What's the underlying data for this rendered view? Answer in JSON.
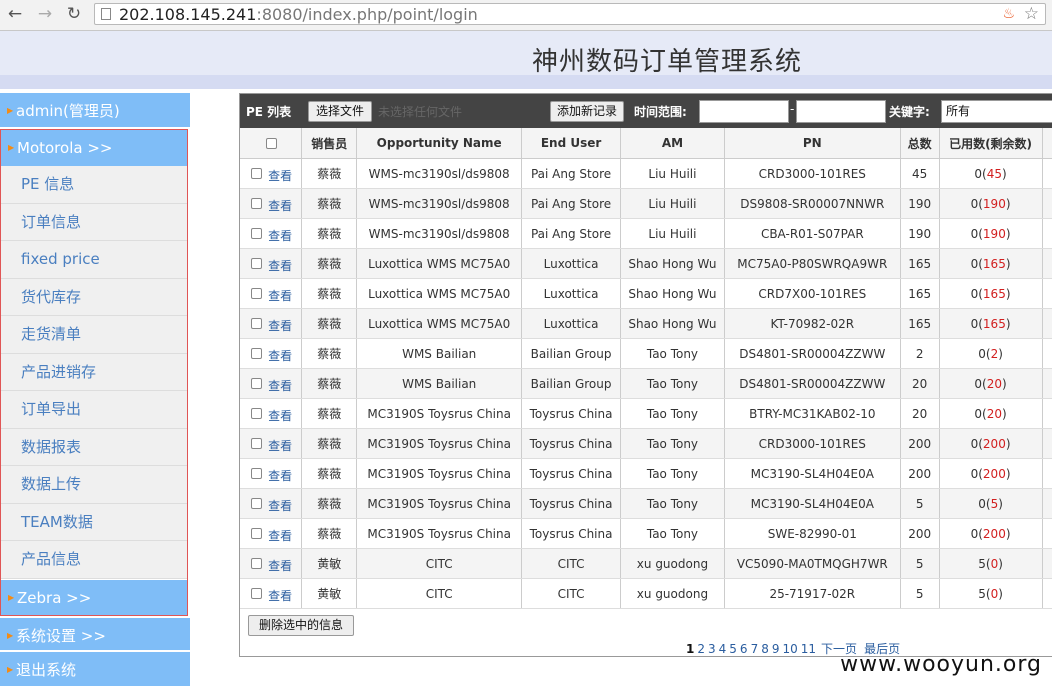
{
  "browser": {
    "url_host": "202.108.145.241",
    "url_rest": ":8080/index.php/point/login"
  },
  "header": {
    "title": "神州数码订单管理系统"
  },
  "sidebar": {
    "admin": "admin(管理员)",
    "motorola": "Motorola >>",
    "items": [
      "PE 信息",
      "订单信息",
      "fixed price",
      "货代库存",
      "走货清单",
      "产品进销存",
      "订单导出",
      "数据报表",
      "数据上传",
      "TEAM数据",
      "产品信息"
    ],
    "zebra": "Zebra >>",
    "settings": "系统设置 >>",
    "logout": "退出系统"
  },
  "toolbar": {
    "list_label": "PE 列表",
    "choose_file": "选择文件",
    "no_file": "未选择任何文件",
    "add_record": "添加新记录",
    "time_range_label": "时间范围:",
    "date_separator": "-",
    "keyword_label": "关键字:",
    "keyword_value": "所有"
  },
  "table": {
    "columns": [
      "",
      "销售员",
      "Opportunity Name",
      "End User",
      "AM",
      "PN",
      "总数",
      "已用数(剩余数)"
    ],
    "view_label": "查看",
    "rows": [
      {
        "sales": "蔡薇",
        "opportunity": "WMS-mc3190sl/ds9808",
        "end_user": "Pai Ang Store",
        "am": "Liu Huili",
        "pn": "CRD3000-101RES",
        "total": "45",
        "used": "0",
        "remaining": "45"
      },
      {
        "sales": "蔡薇",
        "opportunity": "WMS-mc3190sl/ds9808",
        "end_user": "Pai Ang Store",
        "am": "Liu Huili",
        "pn": "DS9808-SR00007NNWR",
        "total": "190",
        "used": "0",
        "remaining": "190"
      },
      {
        "sales": "蔡薇",
        "opportunity": "WMS-mc3190sl/ds9808",
        "end_user": "Pai Ang Store",
        "am": "Liu Huili",
        "pn": "CBA-R01-S07PAR",
        "total": "190",
        "used": "0",
        "remaining": "190"
      },
      {
        "sales": "蔡薇",
        "opportunity": "Luxottica WMS MC75A0",
        "end_user": "Luxottica",
        "am": "Shao Hong Wu",
        "pn": "MC75A0-P80SWRQA9WR",
        "total": "165",
        "used": "0",
        "remaining": "165"
      },
      {
        "sales": "蔡薇",
        "opportunity": "Luxottica WMS MC75A0",
        "end_user": "Luxottica",
        "am": "Shao Hong Wu",
        "pn": "CRD7X00-101RES",
        "total": "165",
        "used": "0",
        "remaining": "165"
      },
      {
        "sales": "蔡薇",
        "opportunity": "Luxottica WMS MC75A0",
        "end_user": "Luxottica",
        "am": "Shao Hong Wu",
        "pn": "KT-70982-02R",
        "total": "165",
        "used": "0",
        "remaining": "165"
      },
      {
        "sales": "蔡薇",
        "opportunity": "WMS Bailian",
        "end_user": "Bailian Group",
        "am": "Tao Tony",
        "pn": "DS4801-SR00004ZZWW",
        "total": "2",
        "used": "0",
        "remaining": "2"
      },
      {
        "sales": "蔡薇",
        "opportunity": "WMS Bailian",
        "end_user": "Bailian Group",
        "am": "Tao Tony",
        "pn": "DS4801-SR00004ZZWW",
        "total": "20",
        "used": "0",
        "remaining": "20"
      },
      {
        "sales": "蔡薇",
        "opportunity": "MC3190S Toysrus China",
        "end_user": "Toysrus China",
        "am": "Tao Tony",
        "pn": "BTRY-MC31KAB02-10",
        "total": "20",
        "used": "0",
        "remaining": "20"
      },
      {
        "sales": "蔡薇",
        "opportunity": "MC3190S Toysrus China",
        "end_user": "Toysrus China",
        "am": "Tao Tony",
        "pn": "CRD3000-101RES",
        "total": "200",
        "used": "0",
        "remaining": "200"
      },
      {
        "sales": "蔡薇",
        "opportunity": "MC3190S Toysrus China",
        "end_user": "Toysrus China",
        "am": "Tao Tony",
        "pn": "MC3190-SL4H04E0A",
        "total": "200",
        "used": "0",
        "remaining": "200"
      },
      {
        "sales": "蔡薇",
        "opportunity": "MC3190S Toysrus China",
        "end_user": "Toysrus China",
        "am": "Tao Tony",
        "pn": "MC3190-SL4H04E0A",
        "total": "5",
        "used": "0",
        "remaining": "5"
      },
      {
        "sales": "蔡薇",
        "opportunity": "MC3190S Toysrus China",
        "end_user": "Toysrus China",
        "am": "Tao Tony",
        "pn": "SWE-82990-01",
        "total": "200",
        "used": "0",
        "remaining": "200"
      },
      {
        "sales": "黄敏",
        "opportunity": "CITC",
        "end_user": "CITC",
        "am": "xu guodong",
        "pn": "VC5090-MA0TMQGH7WR",
        "total": "5",
        "used": "5",
        "remaining": "0"
      },
      {
        "sales": "黄敏",
        "opportunity": "CITC",
        "end_user": "CITC",
        "am": "xu guodong",
        "pn": "25-71917-02R",
        "total": "5",
        "used": "5",
        "remaining": "0"
      }
    ]
  },
  "actions": {
    "delete_selected": "删除选中的信息"
  },
  "pagination": {
    "pages": [
      "1",
      "2",
      "3",
      "4",
      "5",
      "6",
      "7",
      "8",
      "9",
      "10",
      "11"
    ],
    "current": "1",
    "next": "下一页",
    "last": "最后页"
  },
  "watermark": "www.wooyun.org",
  "colors": {
    "sidebar_header": "#7fbdf7",
    "toolbar": "#444444",
    "remaining_value": "#d21f1f",
    "link": "#2a5d9f"
  }
}
